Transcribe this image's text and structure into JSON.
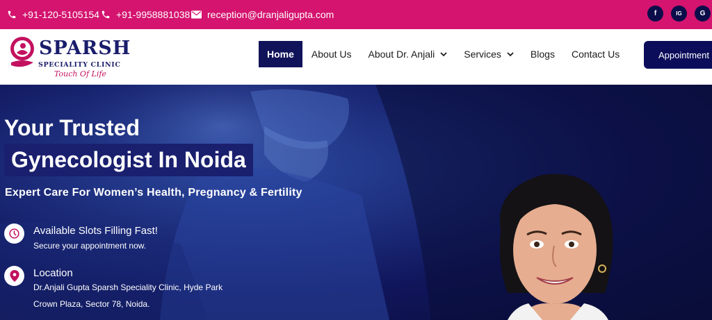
{
  "topbar": {
    "phone1": "+91-120-5105154",
    "phone2": "+91-9958881038",
    "email": "reception@dranjaligupta.com",
    "socials": [
      "f",
      "IG",
      "G"
    ],
    "color": "#d4146f"
  },
  "header": {
    "logo": {
      "title": "SPARSH",
      "subtitle": "SPECIALITY CLINIC",
      "tagline": "Touch Of Life"
    },
    "nav": [
      {
        "label": "Home",
        "active": true
      },
      {
        "label": "About Us"
      },
      {
        "label": "About Dr. Anjali",
        "dropdown": true
      },
      {
        "label": "Services",
        "dropdown": true
      },
      {
        "label": "Blogs"
      },
      {
        "label": "Contact Us"
      }
    ],
    "appointment_label": "Appointment",
    "accent": "#10125a"
  },
  "hero": {
    "title_line1": "Your Trusted",
    "title_line2": "Gynecologist In Noida",
    "subtitle": "Expert Care For Women’s Health, Pregnancy & Fertility",
    "info": [
      {
        "icon": "clock-icon",
        "title": "Available Slots Filling Fast!",
        "text": "Secure your appointment now."
      },
      {
        "icon": "location-pin-icon",
        "title": "Location",
        "text1": "Dr.Anjali Gupta Sparsh Speciality Clinic, Hyde Park",
        "text2": "Crown Plaza, Sector 78, Noida."
      }
    ]
  }
}
